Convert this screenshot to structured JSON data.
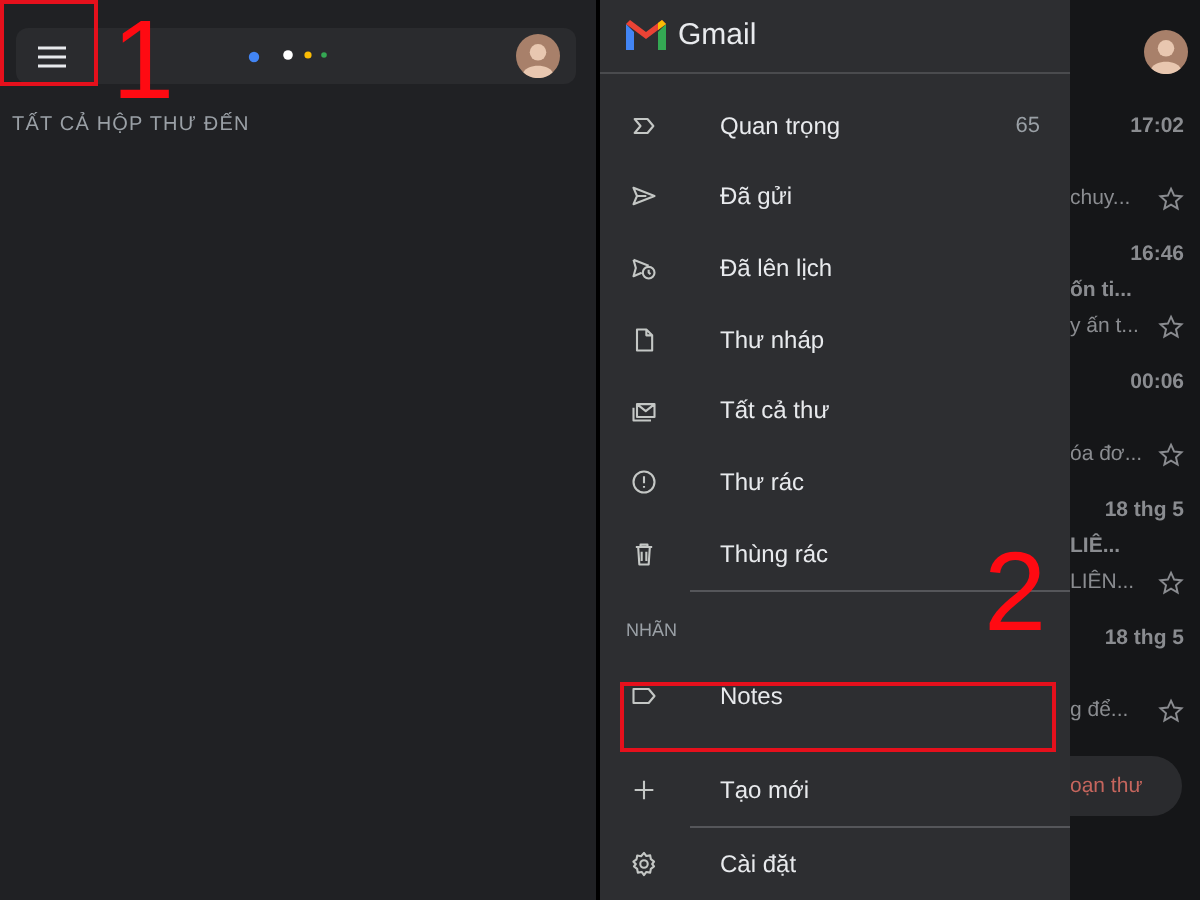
{
  "inbox_screen": {
    "section_title": "TẤT CẢ HỘP THƯ ĐẾN"
  },
  "drawer": {
    "title": "Gmail",
    "items": [
      {
        "kind": "important",
        "label": "Quan trọng",
        "count": "65"
      },
      {
        "kind": "sent",
        "label": "Đã gửi"
      },
      {
        "kind": "scheduled",
        "label": "Đã lên lịch"
      },
      {
        "kind": "draft",
        "label": "Thư nháp"
      },
      {
        "kind": "all",
        "label": "Tất cả thư"
      },
      {
        "kind": "spam",
        "label": "Thư rác"
      },
      {
        "kind": "trash",
        "label": "Thùng rác"
      }
    ],
    "labels_heading": "NHÃN",
    "labels": [
      {
        "kind": "label",
        "label": "Notes"
      }
    ],
    "actions": [
      {
        "kind": "add",
        "label": "Tạo mới"
      },
      {
        "kind": "settings",
        "label": "Cài đặt"
      }
    ]
  },
  "background_list": {
    "emails": [
      {
        "time": "17:02",
        "snippet": "chuy..."
      },
      {
        "time": "16:46",
        "subject": "ốn ti...",
        "snippet": "y ấn t..."
      },
      {
        "time": "00:06",
        "snippet": "óa đơ..."
      },
      {
        "time": "18 thg 5",
        "subject": "LIÊ...",
        "snippet": "LIÊN..."
      },
      {
        "time": "18 thg 5",
        "snippet": "g để..."
      }
    ],
    "compose_button": "oạn thư"
  },
  "annotations": [
    "1",
    "2"
  ]
}
